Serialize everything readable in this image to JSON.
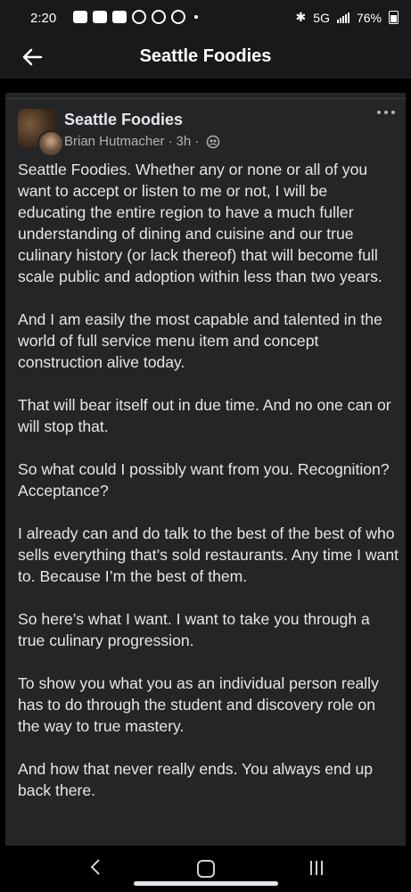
{
  "status_bar": {
    "time": "2:20",
    "network": "5G",
    "battery": "76%"
  },
  "header": {
    "title": "Seattle Foodies"
  },
  "post": {
    "group_name": "Seattle Foodies",
    "author": "Brian Hutmacher",
    "time": "3h",
    "paragraphs": [
      "Seattle Foodies. Whether any or none or all of you want to accept or listen to me or not, I will be educating the entire region to have a much fuller understanding of dining and cuisine and our true culinary history (or lack thereof) that will become full scale public and adoption within less than two years.",
      "And I am easily the most capable and talented in the world of full service menu item and concept construction alive today.",
      "That will bear itself out in due time.  And no one can or will stop that.",
      "So what could I possibly want from you. Recognition?  Acceptance?",
      "I already can and do talk to the best of the best of who sells everything that’s sold restaurants. Any time I want to. Because I’m the best of them.",
      "So here’s what I want.  I want to take you through a true culinary progression.",
      "To show you what you as an individual person really has to do through the student and discovery role on the way to true mastery.",
      "And how that never really ends. You always end up back there."
    ]
  },
  "colors": {
    "background": "#000000",
    "bar": "#18191a",
    "card": "#242526",
    "primary_text": "#e4e6eb",
    "secondary_text": "#b0b3b8"
  }
}
